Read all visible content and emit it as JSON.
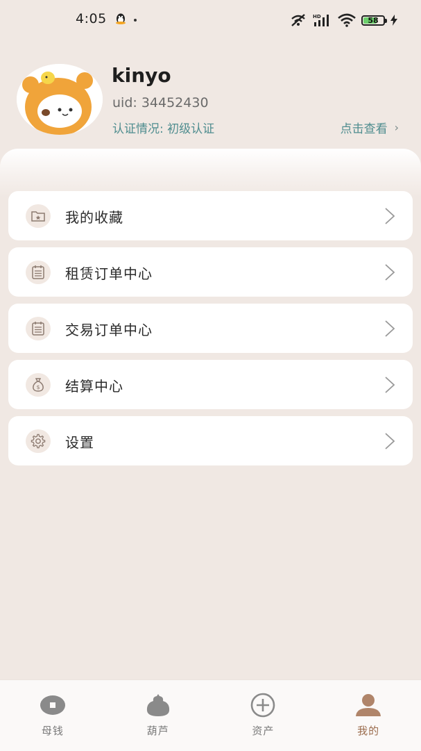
{
  "status_bar": {
    "time": "4:05",
    "battery_level": "58",
    "icons": [
      "qq-icon",
      "mute-icon",
      "signal-icon",
      "wifi-icon",
      "battery-icon",
      "charging-icon"
    ]
  },
  "profile": {
    "username": "kinyo",
    "uid_label": "uid: ",
    "uid": "34452430",
    "cert_label": "认证情况: ",
    "cert_level": "初级认证",
    "view_label": "点击查看"
  },
  "menu": {
    "items": [
      {
        "label": "我的收藏",
        "icon": "favorites-folder-icon"
      },
      {
        "label": "租赁订单中心",
        "icon": "rental-orders-icon"
      },
      {
        "label": "交易订单中心",
        "icon": "trade-orders-icon"
      },
      {
        "label": "结算中心",
        "icon": "money-bag-icon"
      },
      {
        "label": "设置",
        "icon": "gear-icon"
      }
    ]
  },
  "tabbar": {
    "tabs": [
      {
        "label": "母钱",
        "icon": "coin-icon",
        "active": false
      },
      {
        "label": "葫芦",
        "icon": "gourd-icon",
        "active": false
      },
      {
        "label": "资产",
        "icon": "plus-circle-icon",
        "active": false
      },
      {
        "label": "我的",
        "icon": "person-icon",
        "active": true
      }
    ]
  },
  "colors": {
    "background": "#f0e8e3",
    "accent_teal": "#4f8d8f",
    "active_tab": "#9b6c4d",
    "icon_bg": "#f1e8e2"
  }
}
